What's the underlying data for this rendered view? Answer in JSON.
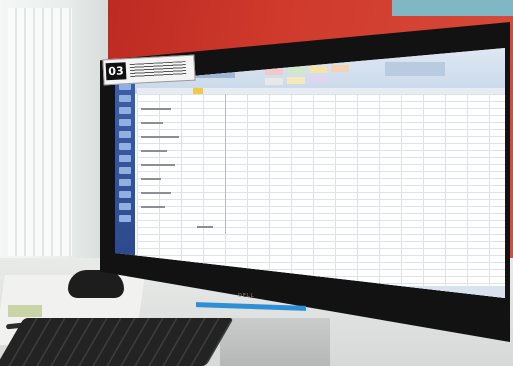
{
  "scene": {
    "badge_number": "03",
    "monitor_brand": "DELL",
    "app": "spreadsheet"
  },
  "colors": {
    "wall": "#cf3a2c",
    "ribbon": "#c9d8ea",
    "sidebar": "#2a4689",
    "accent_bar": "#2f8fd6"
  }
}
